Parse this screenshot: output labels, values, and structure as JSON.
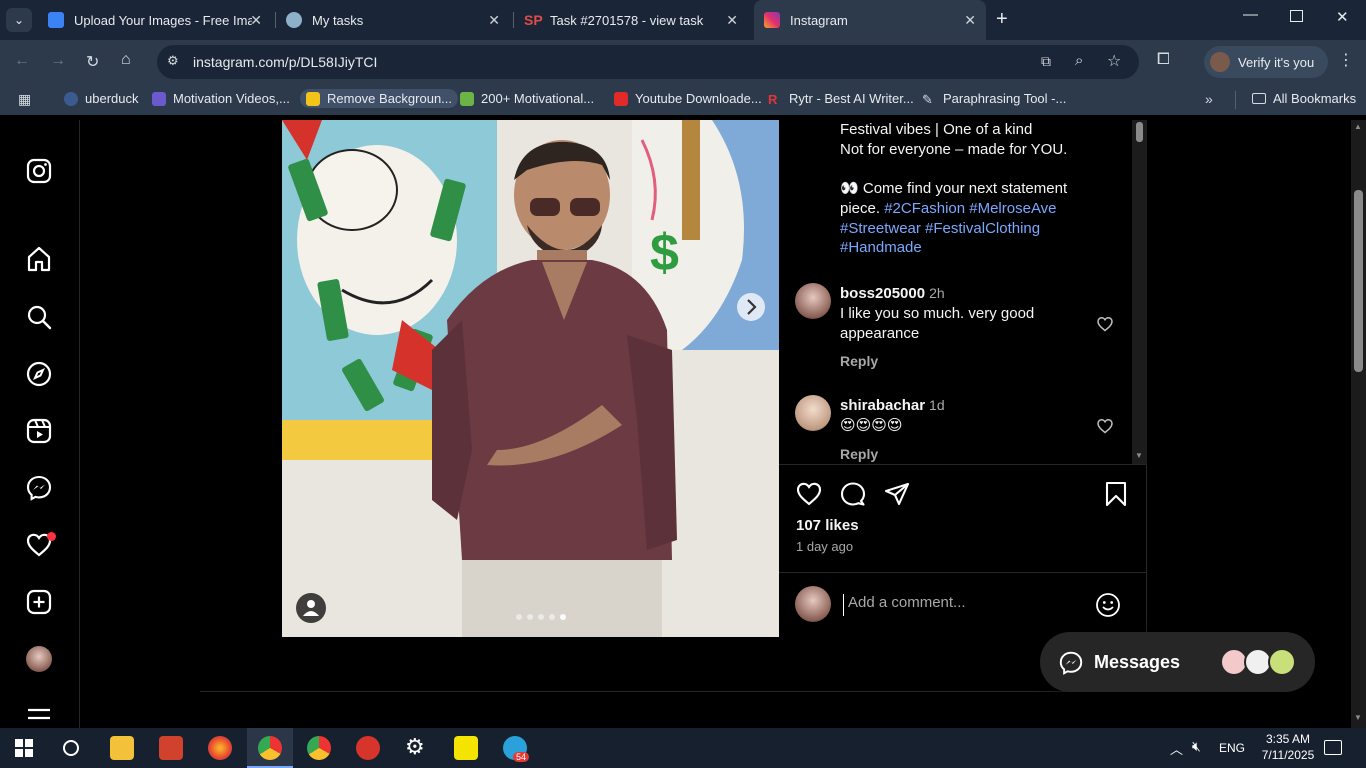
{
  "browser": {
    "tabs": [
      {
        "title": "Upload Your Images - Free Imag",
        "active": false
      },
      {
        "title": "My tasks",
        "active": false
      },
      {
        "title": "Task #2701578 - view task",
        "active": false
      },
      {
        "title": "Instagram",
        "active": true
      }
    ],
    "url": "instagram.com/p/DL58IJiyTCI",
    "verify_label": "Verify it's you",
    "bookmarks": [
      "uberduck",
      "Motivation Videos,...",
      "Remove Backgroun...",
      "200+ Motivational...",
      "Youtube Downloade...",
      "Rytr - Best AI Writer...",
      "Paraphrasing Tool -...",
      "All Bookmarks"
    ]
  },
  "post": {
    "caption_lines": [
      "Festival vibes | One of a kind",
      "Not for everyone – made for YOU.",
      "Come find your next statement",
      "piece."
    ],
    "eye_emoji": "👀",
    "hashtags_line1": "#2CFashion #MelroseAve",
    "hashtags_line2": "#Streetwear #FestivalClothing",
    "hashtags_line3": "#Handmade",
    "comments": [
      {
        "user": "boss205000",
        "time": "2h",
        "text": "I like you so much. very good appearance",
        "reply": "Reply"
      },
      {
        "user": "shirabachar",
        "time": "1d",
        "text": "😍😍😍😍",
        "reply": "Reply"
      }
    ],
    "likes": "107 likes",
    "posted": "1 day ago",
    "comment_placeholder": "Add a comment..."
  },
  "messages": {
    "label": "Messages"
  },
  "taskbar": {
    "lang": "ENG",
    "time": "3:35 AM",
    "date": "7/11/2025",
    "telegram_badge": "54"
  },
  "colors": {
    "accent_link": "#7aa8ff",
    "notification_dot": "#ff3040"
  }
}
